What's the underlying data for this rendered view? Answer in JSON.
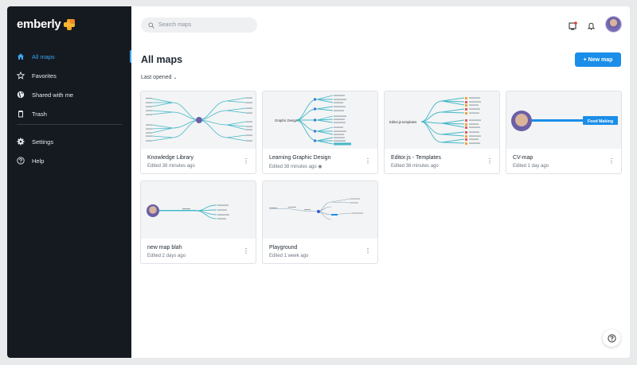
{
  "app": {
    "logo_text": "emberly"
  },
  "sidebar": {
    "items": [
      {
        "label": "All maps",
        "icon": "home-icon"
      },
      {
        "label": "Favorites",
        "icon": "star-icon"
      },
      {
        "label": "Shared with me",
        "icon": "globe-icon"
      },
      {
        "label": "Trash",
        "icon": "trash-icon"
      }
    ],
    "bottom_items": [
      {
        "label": "Settings",
        "icon": "gear-icon"
      },
      {
        "label": "Help",
        "icon": "help-icon"
      }
    ]
  },
  "header": {
    "search_placeholder": "Search maps"
  },
  "main": {
    "title": "All maps",
    "new_button": "+ New map",
    "sort_label": "Last opened"
  },
  "cards": [
    {
      "name": "Knowledge Library",
      "meta": "Edited 38 minutes ago"
    },
    {
      "name": "Learning Graphic Design",
      "meta": "Edited 38 minutes ago",
      "thumb_label": "Graphic Design"
    },
    {
      "name": "Editor.js - Templates",
      "meta": "Edited 38 minutes ago",
      "thumb_label": "Editor.js templates"
    },
    {
      "name": "CV-map",
      "meta": "Edited 1 day ago",
      "thumb_label": "Food Making"
    },
    {
      "name": "new map blah",
      "meta": "Edited 2 days ago"
    },
    {
      "name": "Playground",
      "meta": "Edited 1 week ago"
    }
  ],
  "colors": {
    "accent": "#1a8ee8",
    "sidebar_bg": "#151a21",
    "active": "#39a6f0",
    "branch": "#45b8c9"
  }
}
